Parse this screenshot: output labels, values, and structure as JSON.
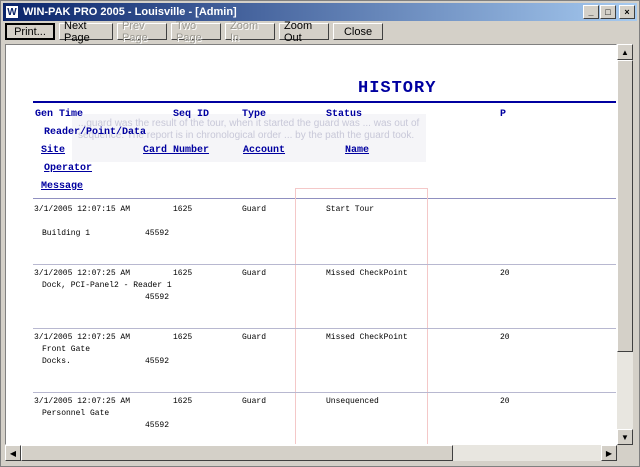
{
  "window": {
    "app_icon": "W",
    "title": "WIN-PAK PRO 2005 - Louisville - [Admin]",
    "controls": {
      "minimize": "_",
      "maximize": "□",
      "close": "×"
    }
  },
  "toolbar": {
    "print": "Print...",
    "next_page": "Next Page",
    "prev_page": "Prev Page",
    "two_page": "Two Page",
    "zoom_in": "Zoom In",
    "zoom_out": "Zoom Out",
    "close": "Close"
  },
  "report": {
    "title": "HISTORY",
    "headers": {
      "gen_time": "Gen Time",
      "seq_id": "Seq ID",
      "type": "Type",
      "status": "Status",
      "p": "P",
      "reader_point_data": "Reader/Point/Data",
      "site": "Site",
      "card_number": "Card Number",
      "account": "Account",
      "name": "Name",
      "operator": "Operator",
      "message": "Message"
    },
    "ghost_text": "...guard was the result of the tour, when it started the guard was ... was out of sequence. The report is in chronological order ... by the path the guard took.",
    "rows": [
      {
        "gen_time": "3/1/2005 12:07:15 AM",
        "seq_id": "1625",
        "type": "Guard",
        "status": "Start Tour",
        "p": "",
        "line2": "",
        "line3": "Building 1",
        "card": "45592"
      },
      {
        "gen_time": "3/1/2005 12:07:25 AM",
        "seq_id": "1625",
        "type": "Guard",
        "status": "Missed CheckPoint",
        "p": "20",
        "line2": "Dock, PCI-Panel2 - Reader 1",
        "line3": "",
        "card": "45592"
      },
      {
        "gen_time": "3/1/2005 12:07:25 AM",
        "seq_id": "1625",
        "type": "Guard",
        "status": "Missed CheckPoint",
        "p": "20",
        "line2": "Front Gate",
        "line3": "Docks.",
        "card": "45592"
      },
      {
        "gen_time": "3/1/2005 12:07:25 AM",
        "seq_id": "1625",
        "type": "Guard",
        "status": "Unsequenced",
        "p": "20",
        "line2": "Personnel Gate",
        "line3": "",
        "card": "45592"
      }
    ]
  }
}
